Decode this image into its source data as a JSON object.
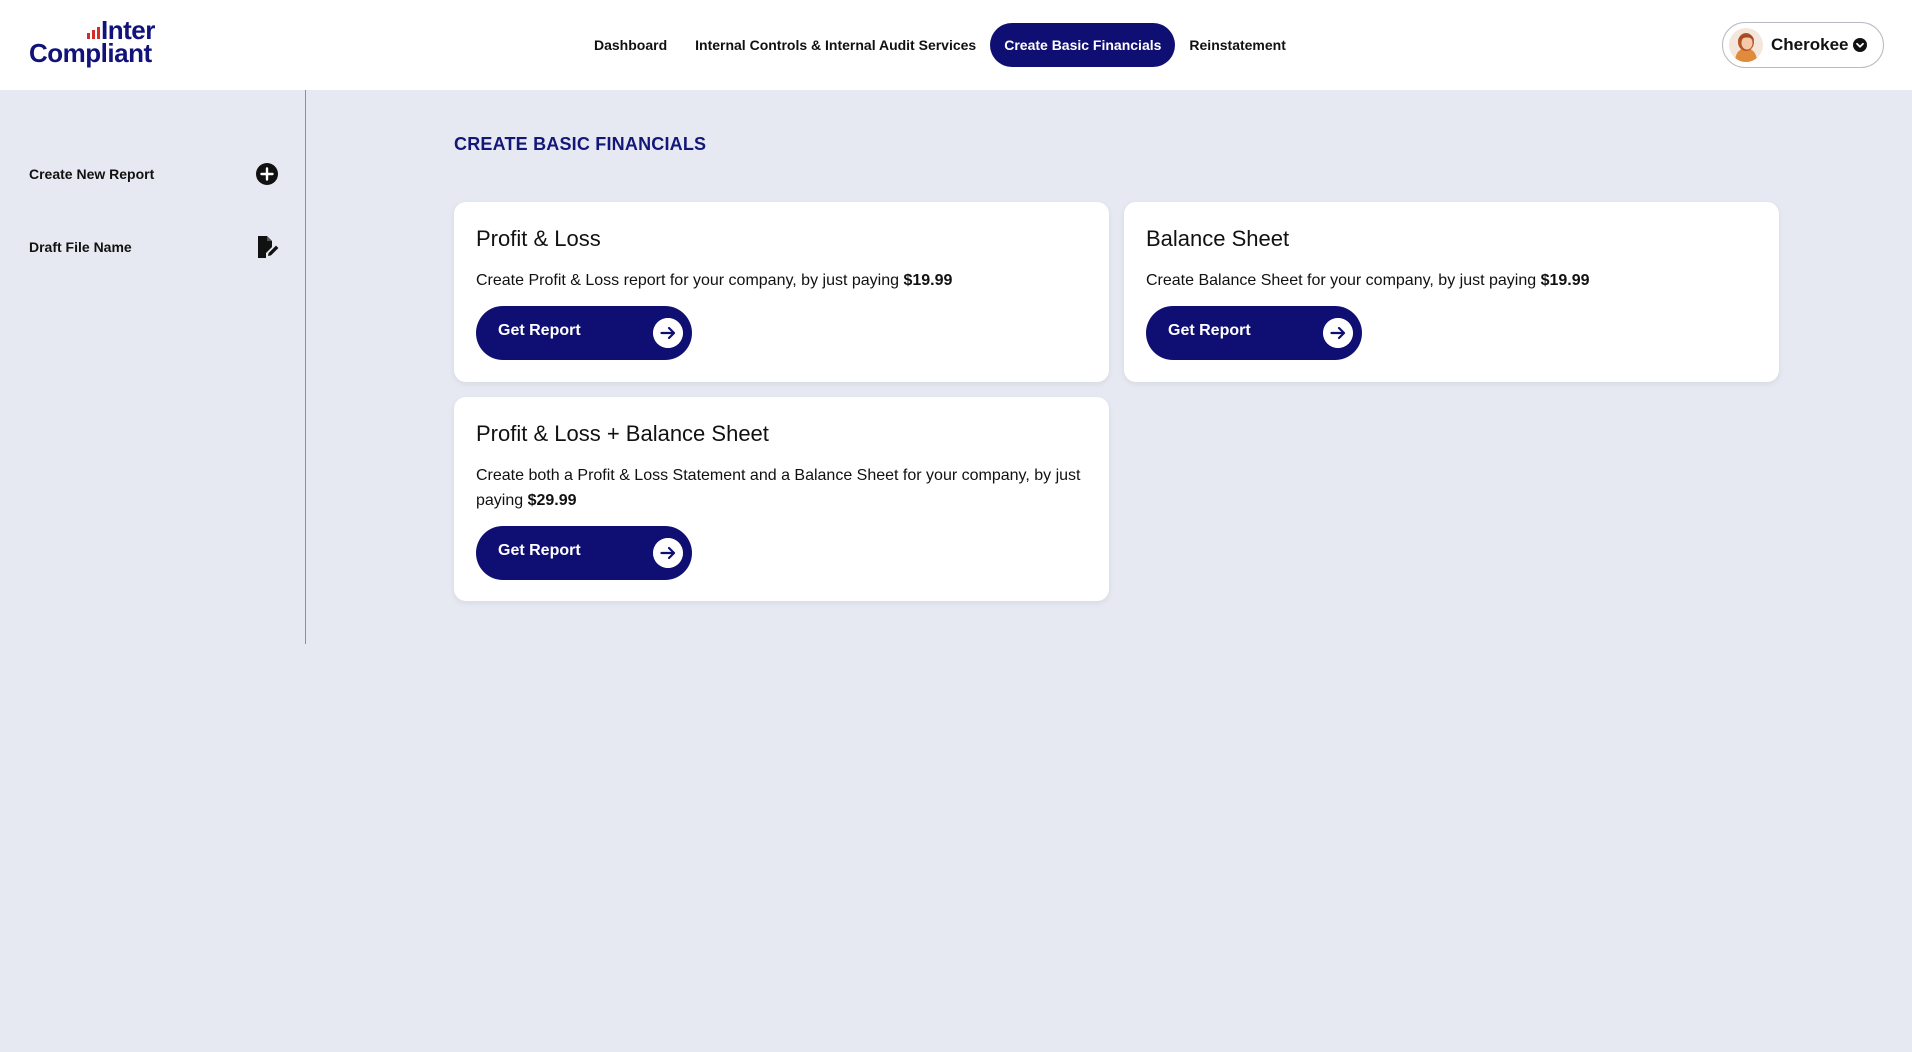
{
  "brand": {
    "logo_top": "Inter",
    "logo_bottom": "Compliant",
    "logo_accent": "#d62b2b",
    "brand_color": "#11137a"
  },
  "nav": {
    "items": [
      {
        "label": "Dashboard",
        "active": false
      },
      {
        "label": "Internal Controls & Internal Audit Services",
        "active": false
      },
      {
        "label": "Create Basic Financials",
        "active": true
      },
      {
        "label": "Reinstatement",
        "active": false
      }
    ]
  },
  "user": {
    "name": "Cherokee",
    "avatar_icon": "user-avatar",
    "menu_icon": "chevron-down-circle-icon"
  },
  "sidebar": {
    "items": [
      {
        "label": "Create New Report",
        "icon": "plus-circle-icon"
      },
      {
        "label": "Draft File Name",
        "icon": "file-edit-icon"
      }
    ]
  },
  "main": {
    "title": "CREATE BASIC FINANCIALS",
    "cards": [
      {
        "title": "Profit & Loss",
        "desc_prefix": "Create Profit & Loss report for your company, by just paying ",
        "price": "$19.99",
        "button": "Get Report"
      },
      {
        "title": "Balance Sheet",
        "desc_prefix": "Create Balance Sheet for your company, by just paying ",
        "price": "$19.99",
        "button": "Get Report"
      },
      {
        "title": "Profit & Loss + Balance Sheet",
        "desc_prefix": "Create both a Profit & Loss Statement and a Balance Sheet for your company, by just paying ",
        "price": "$29.99",
        "button": "Get Report"
      }
    ]
  },
  "colors": {
    "primary": "#0f0f73",
    "background": "#e6e9f1",
    "card": "#ffffff"
  }
}
